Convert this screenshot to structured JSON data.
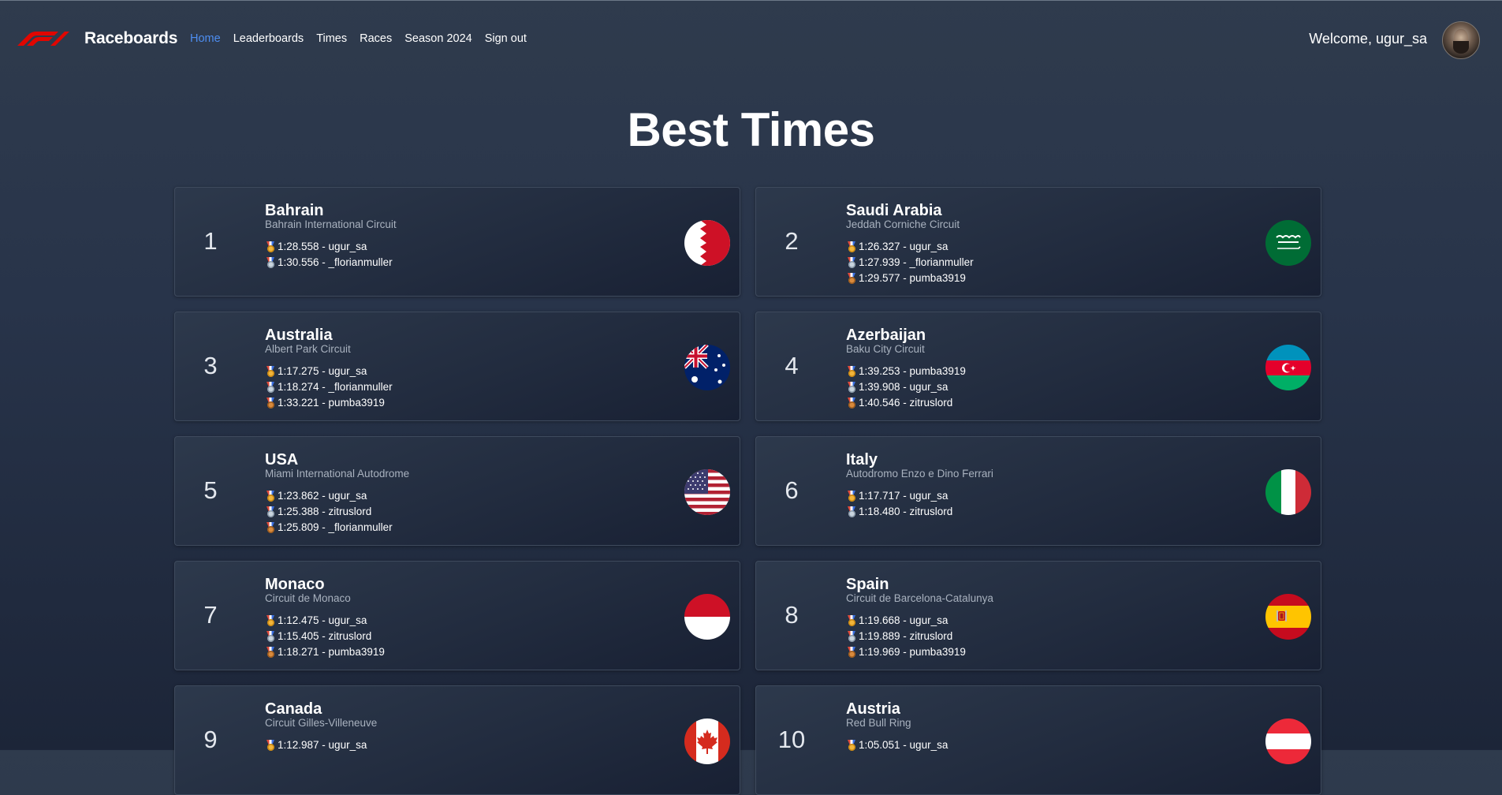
{
  "nav": {
    "brand": "Raceboards",
    "links": [
      "Home",
      "Leaderboards",
      "Times",
      "Races",
      "Season 2024",
      "Sign out"
    ],
    "active": "Home",
    "welcome": "Welcome, ugur_sa",
    "accent_color": "#4d8df0"
  },
  "page": {
    "title": "Best Times"
  },
  "races": [
    {
      "rank": "1",
      "country": "Bahrain",
      "circuit": "Bahrain International Circuit",
      "flag": "bahrain-flag",
      "times": [
        {
          "medal": "gold",
          "text": "1:28.558 - ugur_sa"
        },
        {
          "medal": "silver",
          "text": "1:30.556 - _florianmuller"
        }
      ]
    },
    {
      "rank": "2",
      "country": "Saudi Arabia",
      "circuit": "Jeddah Corniche Circuit",
      "flag": "saudi-arabia-flag",
      "times": [
        {
          "medal": "gold",
          "text": "1:26.327 - ugur_sa"
        },
        {
          "medal": "silver",
          "text": "1:27.939 - _florianmuller"
        },
        {
          "medal": "bronze",
          "text": "1:29.577 - pumba3919"
        }
      ]
    },
    {
      "rank": "3",
      "country": "Australia",
      "circuit": "Albert Park Circuit",
      "flag": "australia-flag",
      "times": [
        {
          "medal": "gold",
          "text": "1:17.275 - ugur_sa"
        },
        {
          "medal": "silver",
          "text": "1:18.274 - _florianmuller"
        },
        {
          "medal": "bronze",
          "text": "1:33.221 - pumba3919"
        }
      ]
    },
    {
      "rank": "4",
      "country": "Azerbaijan",
      "circuit": "Baku City Circuit",
      "flag": "azerbaijan-flag",
      "times": [
        {
          "medal": "gold",
          "text": "1:39.253 - pumba3919"
        },
        {
          "medal": "silver",
          "text": "1:39.908 - ugur_sa"
        },
        {
          "medal": "bronze",
          "text": "1:40.546 - zitruslord"
        }
      ]
    },
    {
      "rank": "5",
      "country": "USA",
      "circuit": "Miami International Autodrome",
      "flag": "usa-flag",
      "times": [
        {
          "medal": "gold",
          "text": "1:23.862 - ugur_sa"
        },
        {
          "medal": "silver",
          "text": "1:25.388 - zitruslord"
        },
        {
          "medal": "bronze",
          "text": "1:25.809 - _florianmuller"
        }
      ]
    },
    {
      "rank": "6",
      "country": "Italy",
      "circuit": "Autodromo Enzo e Dino Ferrari",
      "flag": "italy-flag",
      "times": [
        {
          "medal": "gold",
          "text": "1:17.717 - ugur_sa"
        },
        {
          "medal": "silver",
          "text": "1:18.480 - zitruslord"
        }
      ]
    },
    {
      "rank": "7",
      "country": "Monaco",
      "circuit": "Circuit de Monaco",
      "flag": "monaco-flag",
      "times": [
        {
          "medal": "gold",
          "text": "1:12.475 - ugur_sa"
        },
        {
          "medal": "silver",
          "text": "1:15.405 - zitruslord"
        },
        {
          "medal": "bronze",
          "text": "1:18.271 - pumba3919"
        }
      ]
    },
    {
      "rank": "8",
      "country": "Spain",
      "circuit": "Circuit de Barcelona-Catalunya",
      "flag": "spain-flag",
      "times": [
        {
          "medal": "gold",
          "text": "1:19.668 - ugur_sa"
        },
        {
          "medal": "silver",
          "text": "1:19.889 - zitruslord"
        },
        {
          "medal": "bronze",
          "text": "1:19.969 - pumba3919"
        }
      ]
    },
    {
      "rank": "9",
      "country": "Canada",
      "circuit": "Circuit Gilles-Villeneuve",
      "flag": "canada-flag",
      "times": [
        {
          "medal": "gold",
          "text": "1:12.987 - ugur_sa"
        }
      ]
    },
    {
      "rank": "10",
      "country": "Austria",
      "circuit": "Red Bull Ring",
      "flag": "austria-flag",
      "times": [
        {
          "medal": "gold",
          "text": "1:05.051 - ugur_sa"
        }
      ]
    }
  ]
}
